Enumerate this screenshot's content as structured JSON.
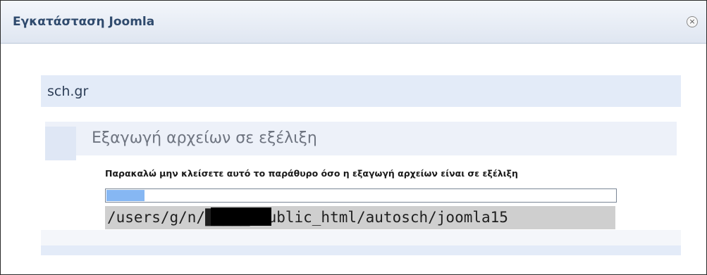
{
  "window": {
    "title": "Εγκατάσταση Joomla",
    "close_symbol": "×",
    "close_icon": "close-circle-icon"
  },
  "site": {
    "name": "sch.gr"
  },
  "task": {
    "title": "Εξαγωγή αρχείων σε εξέλιξη",
    "message": "Παρακαλώ μην κλείσετε αυτό το παράθυρο όσο η εξαγωγή αρχείων είναι σε εξέλιξη",
    "progress_fraction": 0.075,
    "current_path": "/users/g/n/█████/public_html/autosch/joomla15"
  },
  "colors": {
    "progress_fill": "#86b7f3",
    "panel": "#e3ebf8",
    "title_text": "#2f4a6d"
  }
}
